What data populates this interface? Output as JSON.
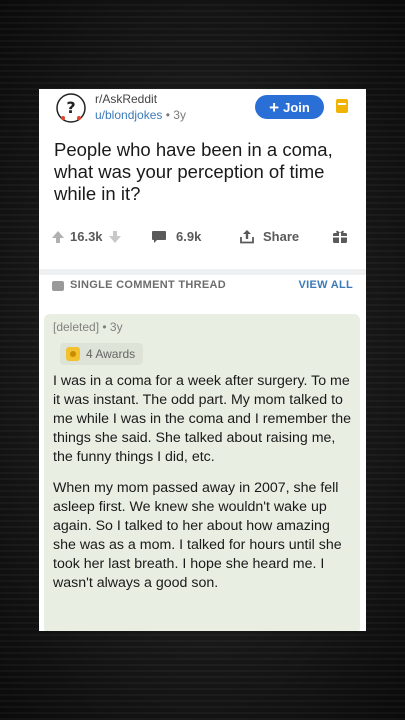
{
  "post": {
    "subreddit": "r/AskReddit",
    "user": "u/blondjokes",
    "age": "• 3y",
    "join_label": "Join",
    "title": "People who have been in a coma, what was your perception of time while in it?"
  },
  "actions": {
    "upvotes": "16.3k",
    "comments": "6.9k",
    "share": "Share"
  },
  "thread": {
    "label": "SINGLE COMMENT THREAD",
    "view_all": "VIEW ALL"
  },
  "comment": {
    "meta": "[deleted] • 3y",
    "awards": "4 Awards",
    "paragraphs": [
      "I was in a coma for a week after surgery. To me it was instant.  The odd part.  My mom talked to me while I was in the coma and I remember the things she said.  She talked about raising me, the funny things I did, etc.",
      "When my mom passed away in 2007, she fell asleep first.  We knew she wouldn't wake up again.  So I talked to her about how amazing she was as a mom.  I talked for hours until she took her last breath.  I hope she heard me. I wasn't always a good son."
    ]
  },
  "colors": {
    "accent": "#2a6fd6",
    "link": "#3b7ab8",
    "comment_bg": "#e8eee2",
    "award": "#f2c12e"
  }
}
